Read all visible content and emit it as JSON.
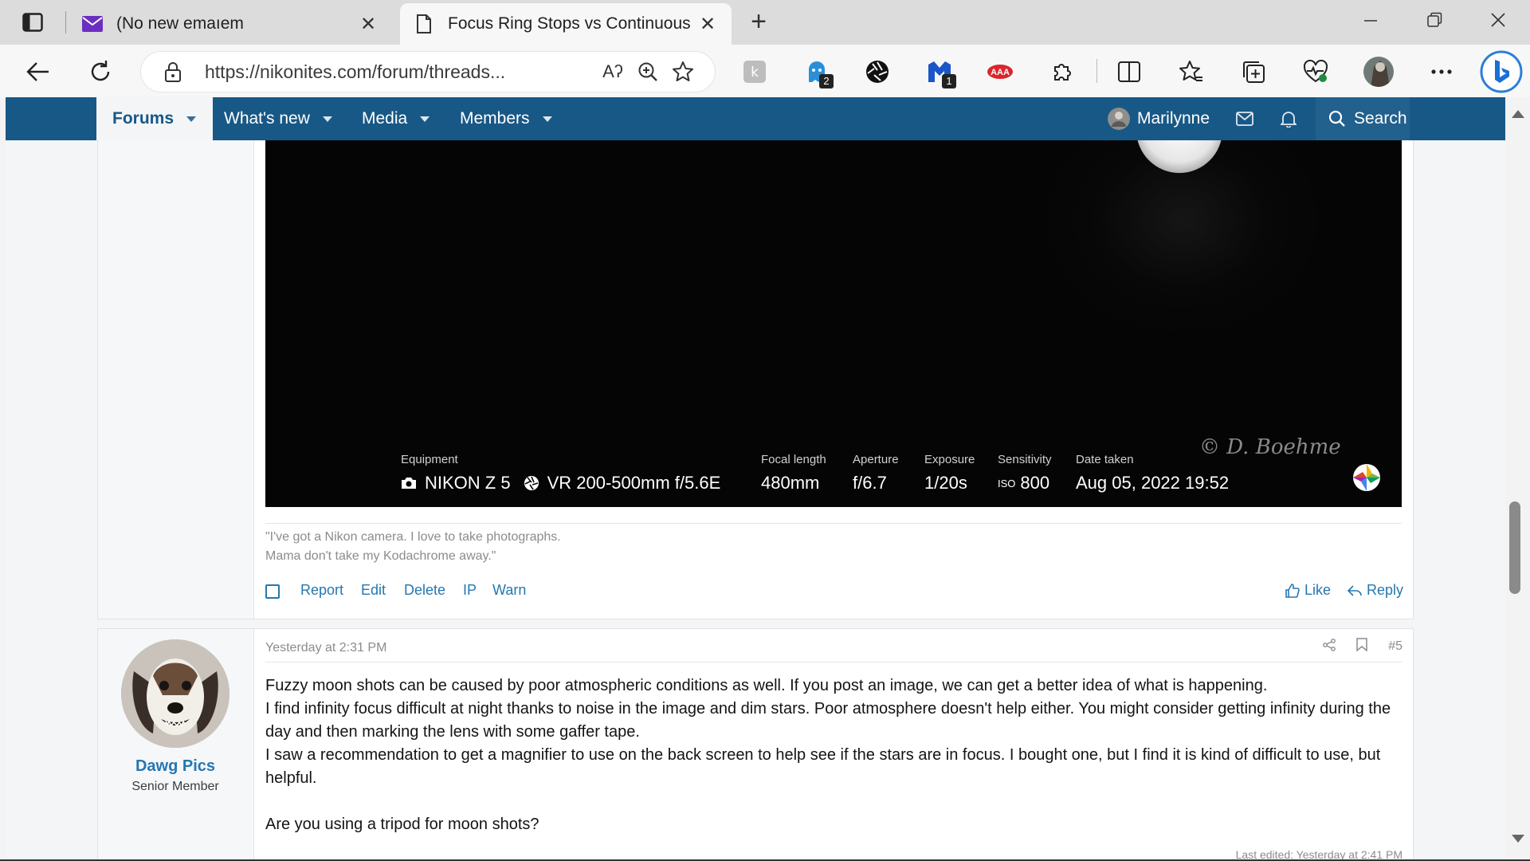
{
  "browser": {
    "tabs": [
      {
        "title": "(No new emaıem",
        "close": "✕"
      },
      {
        "title": "Focus Ring Stops vs Continuous",
        "close": "✕"
      }
    ],
    "new_tab": "+",
    "url": "https://nikonites.com/forum/threads...",
    "read_aloud": "Aʔ",
    "badges": {
      "ext2": "2",
      "ext4": "1"
    }
  },
  "forum_nav": {
    "items": [
      "Forums",
      "What's new",
      "Media",
      "Members"
    ],
    "username": "Marilynne",
    "search": "Search"
  },
  "post1": {
    "exif": {
      "equipment_label": "Equipment",
      "camera": "NIKON Z 5",
      "lens": "VR 200-500mm f/5.6E",
      "focal_label": "Focal length",
      "focal": "480mm",
      "aperture_label": "Aperture",
      "aperture": "f/6.7",
      "exposure_label": "Exposure",
      "exposure": "1/20s",
      "sensitivity_label": "Sensitivity",
      "iso_prefix": "ISO",
      "iso": "800",
      "date_label": "Date taken",
      "date": "Aug 05, 2022 19:52"
    },
    "watermark": "© D. Boehme",
    "signature_line1": "\"I've got a Nikon camera. I love to take photographs.",
    "signature_line2": "Mama don't take my Kodachrome away.\"",
    "actions": {
      "report": "Report",
      "edit": "Edit",
      "delete": "Delete",
      "ip": "IP",
      "warn": "Warn",
      "like": "Like",
      "reply": "Reply"
    }
  },
  "post2": {
    "username": "Dawg Pics",
    "user_title": "Senior Member",
    "date": "Yesterday at 2:31 PM",
    "post_number": "#5",
    "body": [
      "Fuzzy moon shots can be caused by poor atmospheric conditions as well. If you post an image, we can get a better idea of what is happening.",
      "I find infinity focus difficult at night thanks to noise in the image and dim stars. Poor atmosphere doesn't help either. You might consider getting infinity during the day and then marking the lens with some gaffer tape.",
      "I saw a recommendation to get a magnifier to use on the back screen to help see if the stars are in focus. I bought one, but I find it is kind of difficult to use, but helpful.",
      "",
      "Are you using a tripod for moon shots?"
    ],
    "last_edited": "Last edited: Yesterday at 2:41 PM"
  },
  "colors": {
    "forum_blue": "#185886",
    "link_blue": "#2577b1"
  }
}
